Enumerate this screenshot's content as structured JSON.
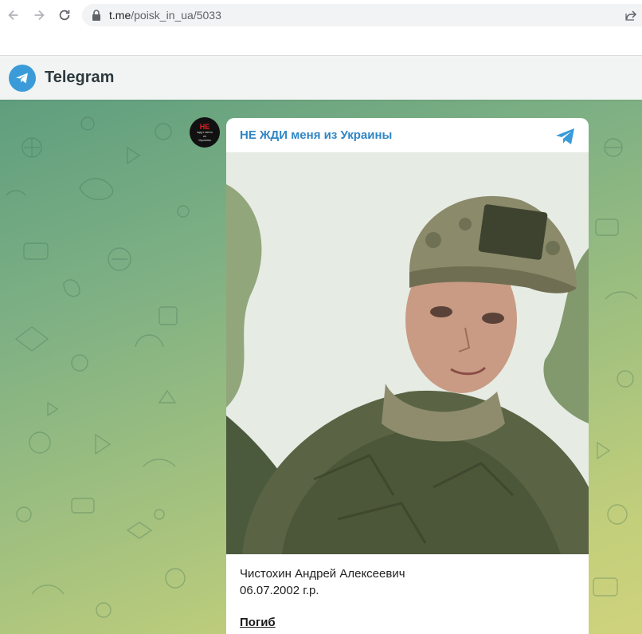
{
  "browser": {
    "url_host": "t.me",
    "url_path": "/poisk_in_ua/5033",
    "back_icon": "arrow-left-icon",
    "forward_icon": "arrow-right-icon",
    "reload_icon": "reload-icon",
    "lock_icon": "lock-icon",
    "share_icon": "share-icon"
  },
  "telegram": {
    "title": "Telegram",
    "logo_color": "#3a9bd8"
  },
  "message": {
    "channel_name": "НЕ ЖДИ меня из Украины",
    "avatar_text": "НЕ",
    "avatar_sub_1": "ждут меня",
    "avatar_sub_2": "из",
    "avatar_sub_3": "Украины",
    "caption_name": "Чистохин Андрей Алексеевич",
    "caption_date": "06.07.2002 г.р.",
    "caption_status": "Погиб",
    "accent_color": "#2f86c5"
  }
}
